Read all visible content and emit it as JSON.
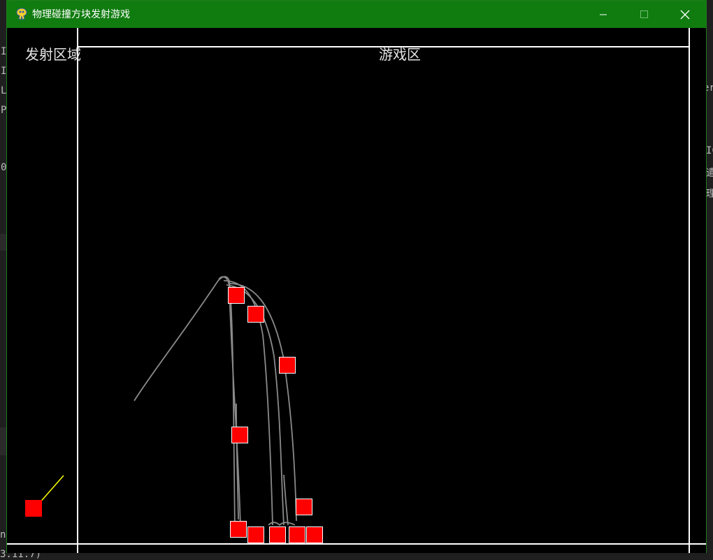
{
  "window": {
    "title": "物理碰撞方块发射游戏",
    "icon": "pygame-snake-icon",
    "controls": [
      "minimize-icon",
      "maximize-icon",
      "close-icon"
    ]
  },
  "game": {
    "left_panel_label": "发射区域",
    "main_panel_label": "游戏区"
  },
  "background": {
    "terminal_fragments_left": [
      "I",
      "I",
      "L",
      "P",
      "0"
    ],
    "terminal_fragments_right": [
      "er",
      "IC",
      "遣",
      "理"
    ],
    "terminal_fragment_bottom": [
      "ne",
      "3.11.7)"
    ]
  },
  "colors": {
    "titlebar": "#107c10",
    "canvas": "#000000",
    "wall": "#ffffff",
    "block_fill": "#ff0000",
    "block_border": "#ffffff",
    "trail": "#808080",
    "aim_line": "#ffff00"
  }
}
